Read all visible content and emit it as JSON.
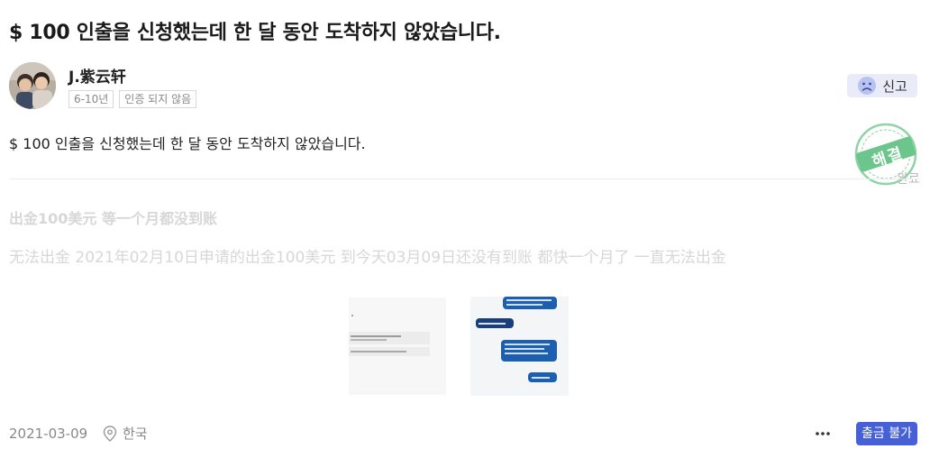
{
  "question": {
    "title": "$ 100 인출을 신청했는데 한 달 동안 도착하지 않았습니다.",
    "body": "$ 100 인출을 신청했는데 한 달 동안 도착하지 않았습니다."
  },
  "author": {
    "name": "J.紫云轩",
    "experience_tag": "6-10년",
    "verification_tag": "인증 되지 않음"
  },
  "report_button": {
    "label": "신고",
    "icon": "sad-face-icon"
  },
  "stamp": {
    "text": "해결",
    "partial_label": "완료",
    "color": "#5bbf7a"
  },
  "original": {
    "title": "出金100美元 等一个月都没到账",
    "body": "无法出金 2021年02月10日申请的出金100美元 到今天03月09日还没有到账 都快一个月了 一直无法出金"
  },
  "footer": {
    "date": "2021-03-09",
    "location": "한국",
    "more_icon": "more-dots-icon",
    "status_badge": "출금 불가"
  },
  "colors": {
    "accent": "#4660d6",
    "report_bg": "#e9ecf8",
    "faded_text": "#d7d7d7"
  }
}
